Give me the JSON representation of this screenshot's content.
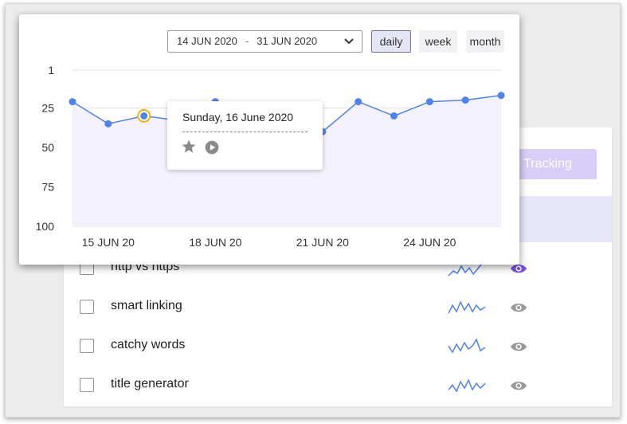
{
  "date_range": {
    "start": "14 JUN 2020",
    "separator": "-",
    "end": "31 JUN 2020"
  },
  "periods": [
    {
      "label": "daily",
      "active": true
    },
    {
      "label": "week",
      "active": false
    },
    {
      "label": "month",
      "active": false
    }
  ],
  "tooltip": {
    "date": "Sunday, 16 June 2020"
  },
  "track_button": {
    "label": "o Tracking"
  },
  "keywords": [
    {
      "label": "http vs https",
      "watched": true
    },
    {
      "label": "smart linking",
      "watched": false
    },
    {
      "label": "catchy words",
      "watched": false
    },
    {
      "label": "title generator",
      "watched": false
    }
  ],
  "colors": {
    "line": "#4e82ef",
    "highlight": "#f5b400",
    "area": "#f3f1fc",
    "watch_active": "#7b52e6",
    "watch_inactive": "#9a9a9a"
  },
  "icons": [
    "chevron-down-icon",
    "star-icon",
    "play-icon",
    "eye-icon",
    "sparkline"
  ],
  "chart_data": {
    "type": "line",
    "x": [
      1,
      2,
      3,
      4,
      5,
      6,
      7,
      8,
      9,
      10,
      11,
      12,
      13
    ],
    "values": [
      21,
      35,
      30,
      33,
      21,
      40,
      42,
      40,
      21,
      30,
      21,
      20,
      17
    ],
    "x_ticks": [
      {
        "x": 2,
        "label": "15 JUN 20"
      },
      {
        "x": 5,
        "label": "18 JUN 20"
      },
      {
        "x": 8,
        "label": "21 JUN 20"
      },
      {
        "x": 11,
        "label": "24 JUN 20"
      }
    ],
    "y_ticks": [
      1,
      25,
      50,
      75,
      100
    ],
    "ylim": [
      1,
      100
    ],
    "y_reversed": true,
    "highlight_index": 2,
    "grid": "horizontal"
  }
}
